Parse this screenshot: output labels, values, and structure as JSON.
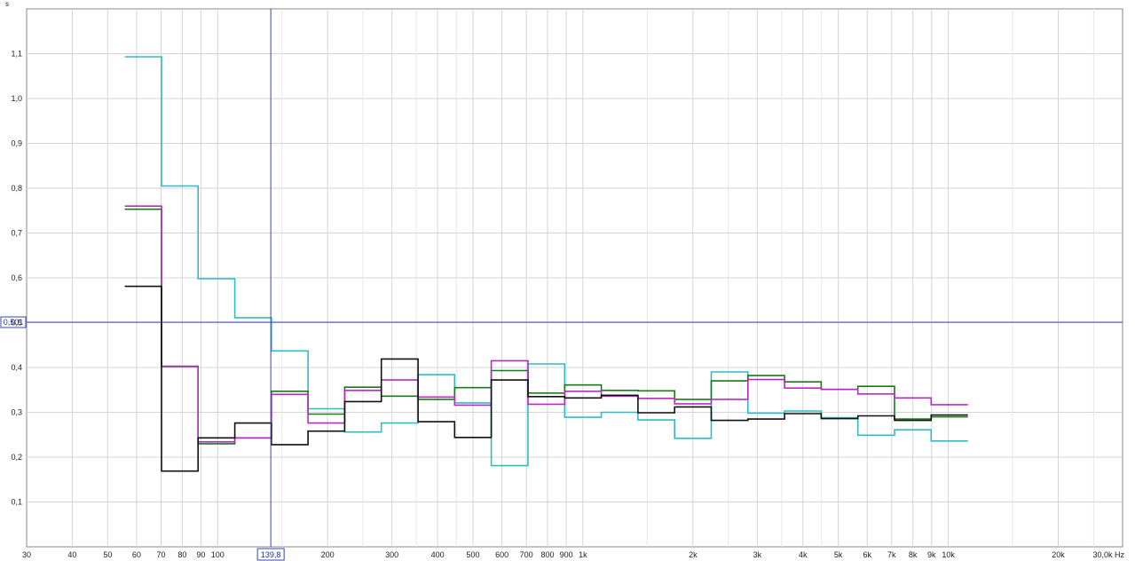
{
  "chart_data": {
    "type": "line",
    "step": true,
    "x_scale": "log",
    "xlim": [
      30,
      30000
    ],
    "ylim": [
      0,
      1.2
    ],
    "ylabel": "s",
    "grid": true,
    "x_ticks": [
      {
        "v": 30,
        "label": "30"
      },
      {
        "v": 40,
        "label": "40"
      },
      {
        "v": 50,
        "label": "50"
      },
      {
        "v": 60,
        "label": "60"
      },
      {
        "v": 70,
        "label": "70"
      },
      {
        "v": 80,
        "label": "80"
      },
      {
        "v": 90,
        "label": "90"
      },
      {
        "v": 100,
        "label": "100"
      },
      {
        "v": 200,
        "label": "200"
      },
      {
        "v": 300,
        "label": "300"
      },
      {
        "v": 400,
        "label": "400"
      },
      {
        "v": 500,
        "label": "500"
      },
      {
        "v": 600,
        "label": "600"
      },
      {
        "v": 700,
        "label": "700"
      },
      {
        "v": 800,
        "label": "800"
      },
      {
        "v": 900,
        "label": "900"
      },
      {
        "v": 1000,
        "label": "1k"
      },
      {
        "v": 2000,
        "label": "2k"
      },
      {
        "v": 3000,
        "label": "3k"
      },
      {
        "v": 4000,
        "label": "4k"
      },
      {
        "v": 5000,
        "label": "5k"
      },
      {
        "v": 6000,
        "label": "6k"
      },
      {
        "v": 7000,
        "label": "7k"
      },
      {
        "v": 8000,
        "label": "8k"
      },
      {
        "v": 9000,
        "label": "9k"
      },
      {
        "v": 10000,
        "label": "10k"
      },
      {
        "v": 20000,
        "label": "20k"
      },
      {
        "v": 30000,
        "label": "30,0k Hz"
      }
    ],
    "y_ticks": [
      {
        "v": 0.1,
        "label": "0,1"
      },
      {
        "v": 0.2,
        "label": "0,2"
      },
      {
        "v": 0.3,
        "label": "0,3"
      },
      {
        "v": 0.4,
        "label": "0,4"
      },
      {
        "v": 0.5,
        "label": "0,5"
      },
      {
        "v": 0.6,
        "label": "0,6"
      },
      {
        "v": 0.7,
        "label": "0,7"
      },
      {
        "v": 0.8,
        "label": "0,8"
      },
      {
        "v": 0.9,
        "label": "0,9"
      },
      {
        "v": 1.0,
        "label": "1,0"
      },
      {
        "v": 1.1,
        "label": "1,1"
      }
    ],
    "x_minor": [
      150,
      250,
      350,
      450,
      1500,
      2500,
      3500,
      4500,
      15000,
      25000
    ],
    "cursor": {
      "x": 139.8,
      "y": 0.501,
      "x_label": "139,8",
      "y_label": "0,501"
    },
    "edges": [
      55.7,
      70.2,
      88.4,
      111.4,
      140.3,
      176.8,
      222.7,
      280.6,
      353.6,
      445.4,
      561.2,
      707.1,
      890.9,
      1122.5,
      1414.2,
      1781.8,
      2244.9,
      2828.4,
      3563.6,
      4489.8,
      5656.9,
      7127.2,
      8979.7,
      11313.7
    ],
    "series": [
      {
        "color": "#2fbcc4",
        "values": [
          1.093,
          0.805,
          0.598,
          0.511,
          0.437,
          0.308,
          0.256,
          0.276,
          0.384,
          0.321,
          0.181,
          0.408,
          0.289,
          0.3,
          0.283,
          0.242,
          0.39,
          0.298,
          0.303,
          0.288,
          0.249,
          0.261,
          0.236
        ]
      },
      {
        "color": "#1a7a1a",
        "values": [
          0.753,
          0.402,
          0.23,
          0.243,
          0.347,
          0.296,
          0.356,
          0.336,
          0.329,
          0.355,
          0.393,
          0.343,
          0.361,
          0.349,
          0.348,
          0.329,
          0.37,
          0.382,
          0.368,
          0.351,
          0.358,
          0.285,
          0.29
        ]
      },
      {
        "color": "#b62bc4",
        "values": [
          0.76,
          0.403,
          0.234,
          0.243,
          0.34,
          0.276,
          0.349,
          0.372,
          0.334,
          0.316,
          0.415,
          0.318,
          0.347,
          0.336,
          0.331,
          0.319,
          0.329,
          0.373,
          0.354,
          0.351,
          0.341,
          0.332,
          0.317
        ]
      },
      {
        "color": "#111111",
        "values": [
          0.581,
          0.169,
          0.243,
          0.276,
          0.228,
          0.258,
          0.324,
          0.419,
          0.279,
          0.244,
          0.372,
          0.335,
          0.332,
          0.338,
          0.299,
          0.312,
          0.282,
          0.285,
          0.297,
          0.286,
          0.292,
          0.282,
          0.294
        ]
      }
    ]
  }
}
